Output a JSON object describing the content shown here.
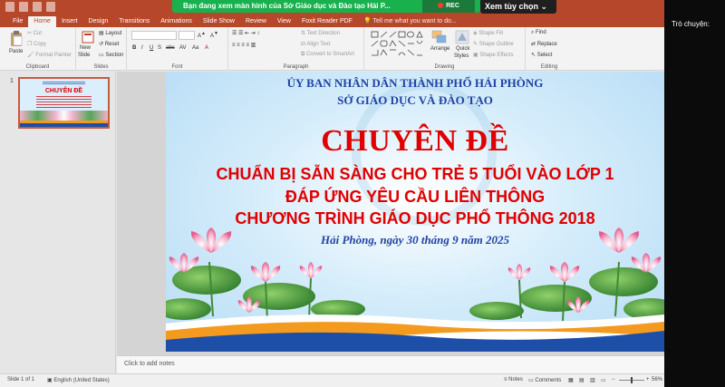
{
  "meeting": {
    "share_banner": "Bạn đang xem màn hình của  Sở Giáo dục và Đào tạo Hải P...",
    "rec_label": "REC",
    "view_options": "Xem tùy chọn",
    "chat_title": "Trò chuyện:"
  },
  "app": {
    "tabs": [
      "File",
      "Home",
      "Insert",
      "Design",
      "Transitions",
      "Animations",
      "Slide Show",
      "Review",
      "View",
      "Foxit Reader PDF"
    ],
    "active_tab": "Home",
    "tell_me": "Tell me what you want to do...",
    "accent_color": "#b7472a"
  },
  "ribbon": {
    "clipboard": {
      "label": "Clipboard",
      "paste": "Paste",
      "cut": "Cut",
      "copy": "Copy",
      "format_painter": "Format Painter"
    },
    "slides": {
      "label": "Slides",
      "new_slide": "New",
      "new_slide2": "Slide",
      "layout": "Layout",
      "reset": "Reset",
      "section": "Section"
    },
    "font": {
      "label": "Font"
    },
    "paragraph": {
      "label": "Paragraph",
      "text_direction": "Text Direction",
      "align_text": "Align Text",
      "smartart": "Convert to SmartArt"
    },
    "drawing": {
      "label": "Drawing",
      "arrange": "Arrange",
      "quick_styles": "Quick",
      "quick_styles2": "Styles",
      "shape_fill": "Shape Fill",
      "shape_outline": "Shape Outline",
      "shape_effects": "Shape Effects"
    },
    "editing": {
      "label": "Editing",
      "find": "Find",
      "replace": "Replace",
      "select": "Select"
    }
  },
  "slide_panel": {
    "slide_number": "1"
  },
  "slide": {
    "org_line1": "ỦY BAN NHÂN DÂN THÀNH PHỐ HẢI PHÒNG",
    "org_line2": "SỞ GIÁO DỤC VÀ ĐÀO TẠO",
    "title": "CHUYÊN ĐỀ",
    "subtitle1": "CHUẨN BỊ SẴN SÀNG CHO TRẺ 5 TUỔI VÀO LỚP 1",
    "subtitle2": "ĐÁP ỨNG YÊU CẦU LIÊN THÔNG",
    "subtitle3": "CHƯƠNG TRÌNH GIÁO DỤC PHỔ THÔNG 2018",
    "date_line": "Hải Phòng, ngày 30 tháng 9 năm 2025",
    "colors": {
      "red": "#e00000",
      "blue": "#2043a5"
    }
  },
  "notes": {
    "placeholder": "Click to add notes"
  },
  "status": {
    "slide_of": "Slide 1 of 1",
    "language": "English (United States)",
    "notes": "Notes",
    "comments": "Comments",
    "zoom": "56%"
  }
}
